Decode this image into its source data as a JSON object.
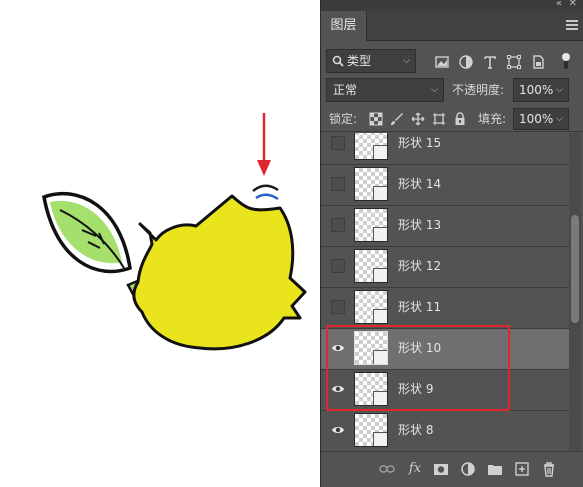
{
  "panel": {
    "tab_label": "图层",
    "filter": {
      "label": "类型",
      "icons": [
        "search-icon",
        "image-filter-icon",
        "adjustment-filter-icon",
        "type-filter-icon",
        "shape-filter-icon",
        "smart-object-filter-icon"
      ]
    },
    "blend_mode": "正常",
    "opacity_label": "不透明度:",
    "opacity_value": "100%",
    "lock_label": "锁定:",
    "lock_icons": [
      "lock-transparent-pixels-icon",
      "lock-image-pixels-icon",
      "lock-position-icon",
      "artboard-lock-icon",
      "lock-all-icon"
    ],
    "fill_label": "填充:",
    "fill_value": "100%",
    "layers": [
      {
        "name": "形状 15",
        "visible": false,
        "selected": false
      },
      {
        "name": "形状 14",
        "visible": false,
        "selected": false
      },
      {
        "name": "形状 13",
        "visible": false,
        "selected": false
      },
      {
        "name": "形状 12",
        "visible": false,
        "selected": false
      },
      {
        "name": "形状 11",
        "visible": false,
        "selected": false
      },
      {
        "name": "形状 10",
        "visible": true,
        "selected": true
      },
      {
        "name": "形状 9",
        "visible": true,
        "selected": false
      },
      {
        "name": "形状 8",
        "visible": true,
        "selected": false
      }
    ],
    "footer_icons": [
      "link-layers-icon",
      "fx-icon",
      "layer-mask-icon",
      "adjustment-layer-icon",
      "new-group-icon",
      "new-layer-icon",
      "delete-icon"
    ],
    "footer_fx": "fx"
  },
  "colors": {
    "panel_bg": "#535353",
    "selected_row": "#6f6f6f",
    "highlight_box": "#e0262e",
    "arrow": "#e0262e",
    "body_fill": "#e9e41c",
    "leaf_fill": "#a5e06c"
  }
}
